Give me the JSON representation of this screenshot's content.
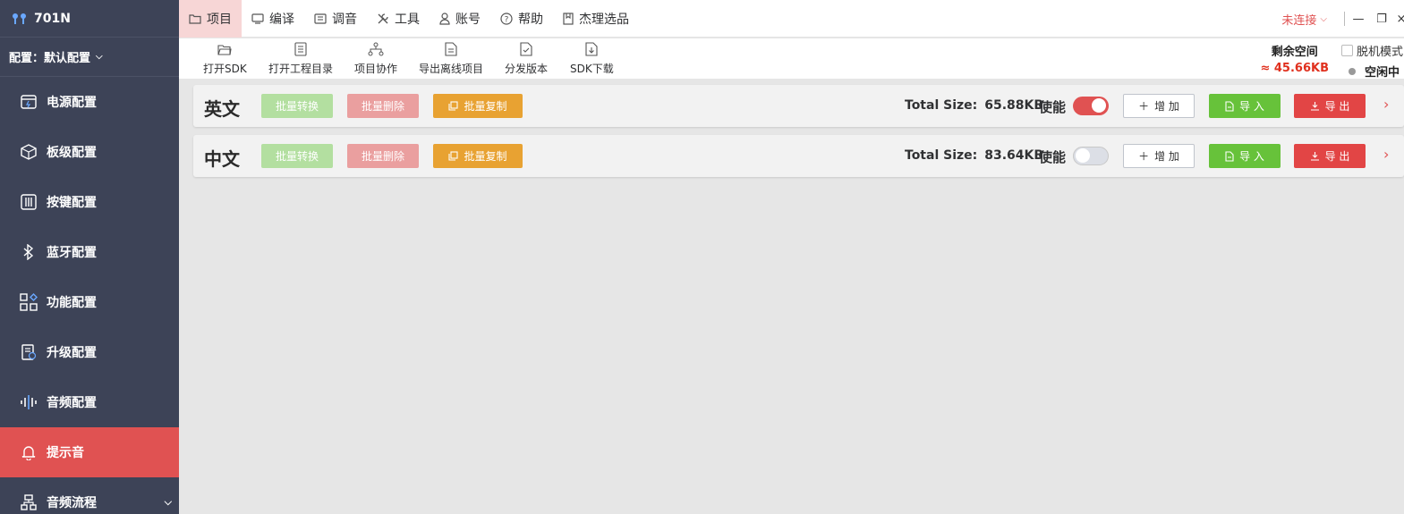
{
  "app": {
    "device_name": "701N",
    "config_label": "配置：默认配置",
    "connection_status": "未连接",
    "accent_color": "#e05252"
  },
  "sidebar": {
    "items": [
      {
        "label": "电源配置",
        "icon": "power-config-icon",
        "active": false
      },
      {
        "label": "板级配置",
        "icon": "board-config-icon",
        "active": false
      },
      {
        "label": "按键配置",
        "icon": "key-config-icon",
        "active": false
      },
      {
        "label": "蓝牙配置",
        "icon": "bluetooth-icon",
        "active": false
      },
      {
        "label": "功能配置",
        "icon": "function-config-icon",
        "active": false
      },
      {
        "label": "升级配置",
        "icon": "upgrade-config-icon",
        "active": false
      },
      {
        "label": "音频配置",
        "icon": "audio-wave-icon",
        "active": false
      },
      {
        "label": "提示音",
        "icon": "bell-icon",
        "active": true
      },
      {
        "label": "音频流程",
        "icon": "flow-icon",
        "active": false
      }
    ]
  },
  "menubar": {
    "items": [
      {
        "label": "项目",
        "icon": "folder-icon",
        "active": true
      },
      {
        "label": "编译",
        "icon": "compile-icon",
        "active": false
      },
      {
        "label": "调音",
        "icon": "tuning-icon",
        "active": false
      },
      {
        "label": "工具",
        "icon": "tools-icon",
        "active": false
      },
      {
        "label": "账号",
        "icon": "user-icon",
        "active": false
      },
      {
        "label": "帮助",
        "icon": "help-icon",
        "active": false
      },
      {
        "label": "杰理选品",
        "icon": "bookmark-icon",
        "active": false
      }
    ]
  },
  "toolbar": {
    "items": [
      {
        "label": "打开SDK",
        "icon": "folder-open-icon"
      },
      {
        "label": "打开工程目录",
        "icon": "list-icon"
      },
      {
        "label": "项目协作",
        "icon": "collaboration-icon"
      },
      {
        "label": "导出离线项目",
        "icon": "export-file-icon"
      },
      {
        "label": "分发版本",
        "icon": "distribute-icon"
      },
      {
        "label": "SDK下载",
        "icon": "download-file-icon"
      }
    ],
    "space_title": "剩余空间",
    "space_value": "≈ 45.66KB",
    "offline_label": "脱机模式",
    "status_label": "空闲中"
  },
  "cards": [
    {
      "lang": "英文",
      "convert_label": "批量转换",
      "delete_label": "批量删除",
      "copy_label": "批量复制",
      "size_label": "Total Size:",
      "size_value": "65.88KB",
      "enable_label": "使能",
      "enabled": true,
      "add_label": "增 加",
      "import_label": "导 入",
      "export_label": "导 出"
    },
    {
      "lang": "中文",
      "convert_label": "批量转换",
      "delete_label": "批量删除",
      "copy_label": "批量复制",
      "size_label": "Total Size:",
      "size_value": "83.64KB",
      "enable_label": "使能",
      "enabled": false,
      "add_label": "增 加",
      "import_label": "导 入",
      "export_label": "导 出"
    }
  ]
}
